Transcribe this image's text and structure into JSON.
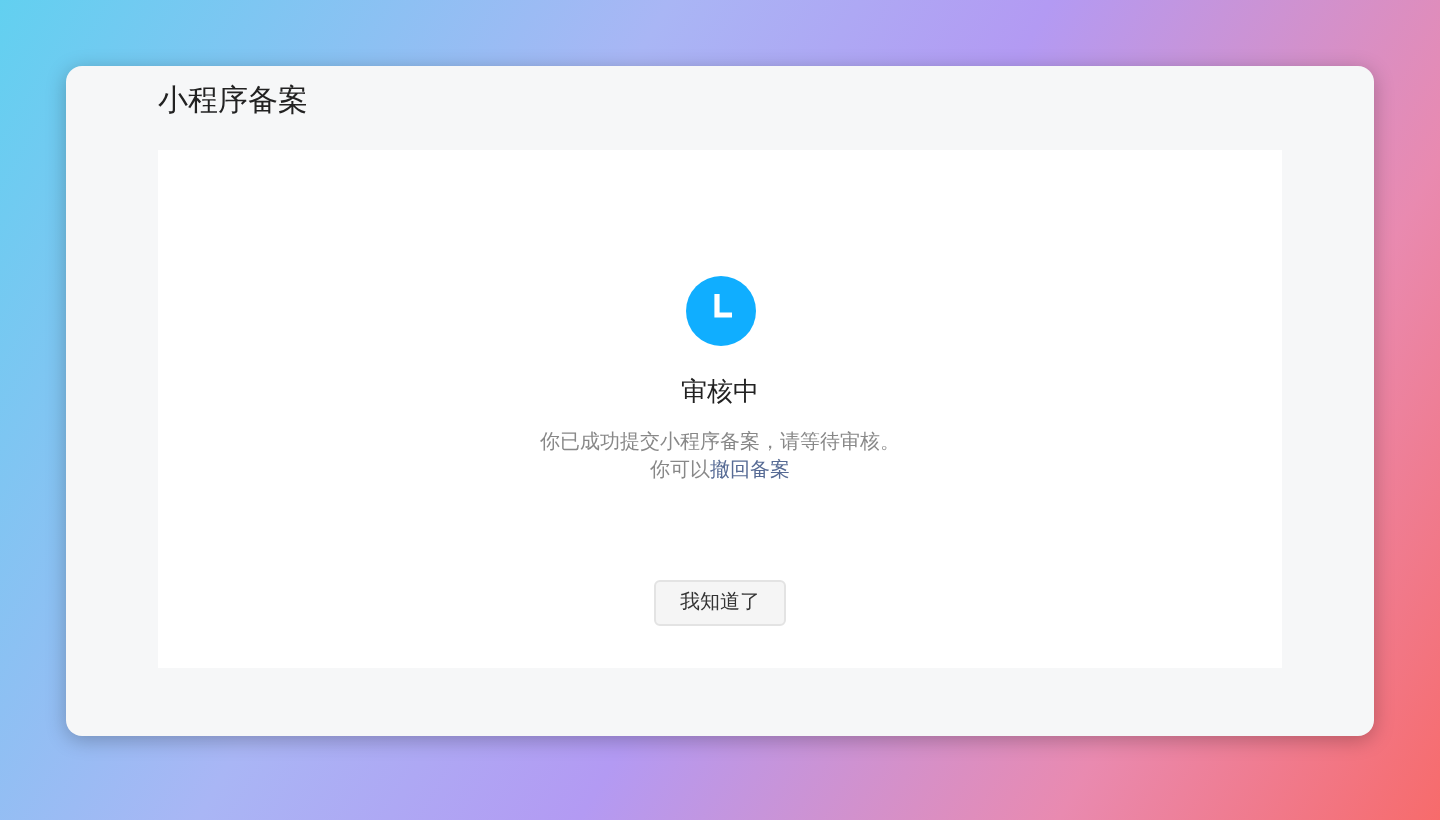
{
  "window": {
    "title": "小程序备案"
  },
  "status": {
    "title": "审核中",
    "message": "你已成功提交小程序备案，请等待审核。",
    "hint": "你可以",
    "link": "撤回备案"
  },
  "buttons": [
    "我知道了"
  ]
}
